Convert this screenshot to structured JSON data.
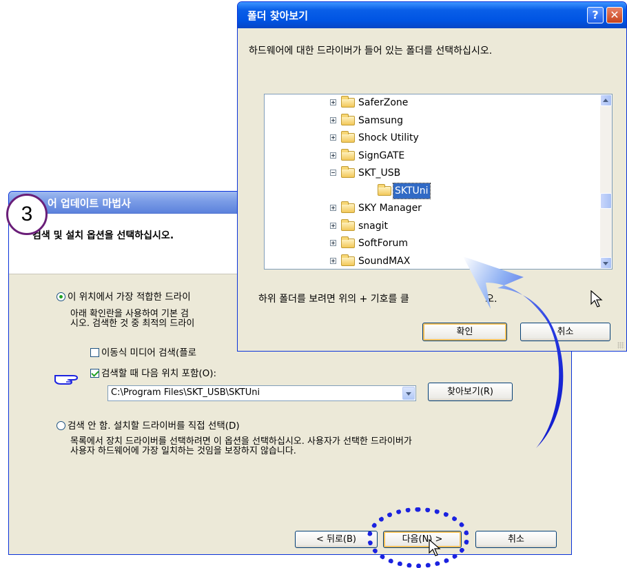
{
  "wizard": {
    "title": "어 업데이트 마법사",
    "heading": "검색 및 설치 옵션을 선택하십시오.",
    "option_search_label": "이 위치에서 가장 적합한 드라이",
    "option_search_desc1": "아래 확인란을 사용하여 기본 검",
    "option_search_desc2": "시오. 검색한 것 중 최적의 드라이",
    "check_removable_label": "이동식 미디어 검색(플로",
    "check_include_label": "검색할 때 다음 위치 포함(O):",
    "path_value": "C:\\Program Files\\SKT_USB\\SKTUni",
    "browse_button": "찾아보기(R)",
    "option_manual_label": "검색 안 함. 설치할 드라이버를 직접 선택(D)",
    "option_manual_desc1": "목록에서 장치 드라이버를 선택하려면 이 옵션을 선택하십시오. 사용자가 선택한 드라이버가",
    "option_manual_desc2": "사용자 하드웨어에 가장 일치하는 것임을 보장하지 않습니다.",
    "back_button": "< 뒤로(B)",
    "next_button": "다음(N) >",
    "cancel_button": "취소"
  },
  "step_badge": "3",
  "browse_dialog": {
    "title": "폴더 찾아보기",
    "description": "하드웨어에 대한 드라이버가 들어 있는 폴더를 선택하십시오.",
    "folders": [
      {
        "label": "SaferZone",
        "expander": "plus"
      },
      {
        "label": "Samsung",
        "expander": "plus"
      },
      {
        "label": "Shock Utility",
        "expander": "plus"
      },
      {
        "label": "SignGATE",
        "expander": "plus"
      },
      {
        "label": "SKT_USB",
        "expander": "minus"
      },
      {
        "label": "SKTUni",
        "expander": "none",
        "selected": true
      },
      {
        "label": "SKY Manager",
        "expander": "plus"
      },
      {
        "label": "snagit",
        "expander": "plus"
      },
      {
        "label": "SoftForum",
        "expander": "plus"
      },
      {
        "label": "SoundMAX",
        "expander": "plus"
      }
    ],
    "hint": "하위 폴더를 보려면 위의 + 기호를 클",
    "hint_end": "오.",
    "ok_button": "확인",
    "cancel_button": "취소",
    "help_label": "?",
    "close_label": "✕"
  },
  "colors": {
    "xp_blue": "#0054e3",
    "annotation_arrow": "#0a1fd6",
    "badge_ring": "#6a1e78"
  }
}
